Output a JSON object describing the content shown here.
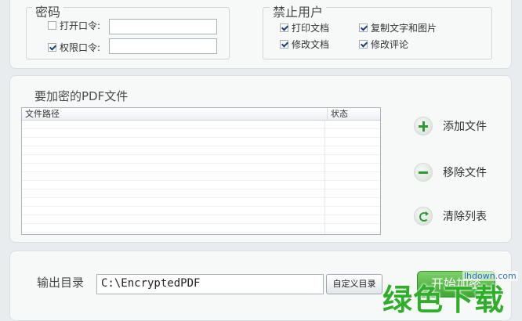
{
  "password_group": {
    "legend": "密码",
    "open_password_label": "打开口令:",
    "open_password_value": "",
    "permission_password_label": "权限口令:",
    "permission_password_value": ""
  },
  "restrict_group": {
    "legend": "禁止用户",
    "options": [
      {
        "label": "打印文档"
      },
      {
        "label": "复制文字和图片"
      },
      {
        "label": "修改文档"
      },
      {
        "label": "修改评论"
      }
    ]
  },
  "files_section": {
    "title": "要加密的PDF文件",
    "columns": [
      "文件路径",
      "状态"
    ],
    "add_label": "添加文件",
    "remove_label": "移除文件",
    "clear_label": "清除列表"
  },
  "output": {
    "label": "输出目录",
    "path": "C:\\EncryptedPDF",
    "custom_button": "自定义目录",
    "encrypt_button": "开始加密"
  },
  "watermark": {
    "url": "lhdown.com",
    "text": "绿色下载"
  }
}
